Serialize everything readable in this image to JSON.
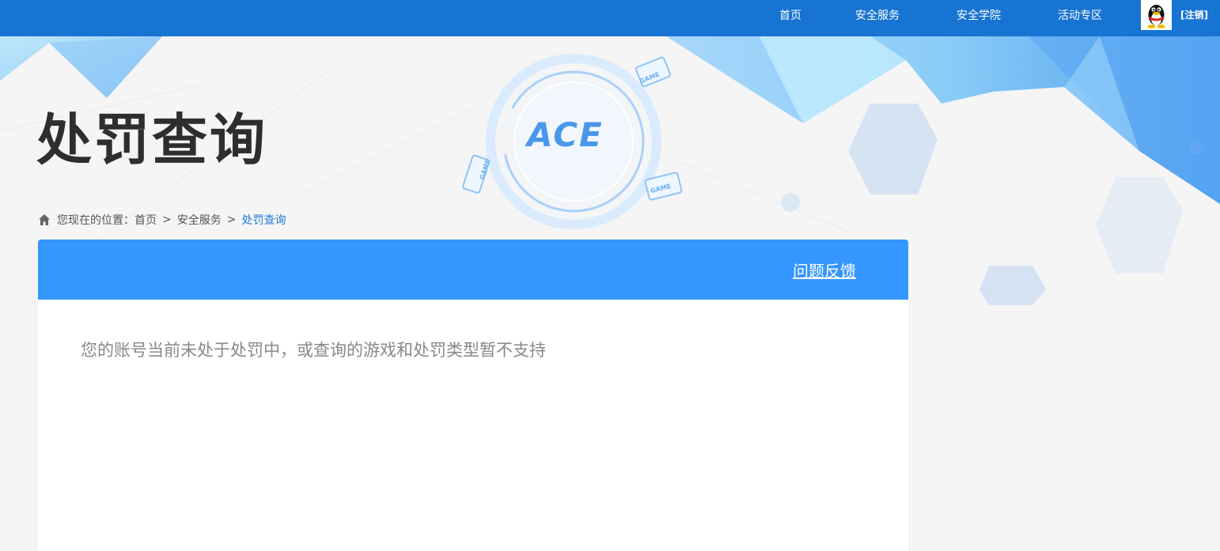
{
  "nav": {
    "items": [
      {
        "label": "首页"
      },
      {
        "label": "安全服务"
      },
      {
        "label": "安全学院"
      },
      {
        "label": "活动专区"
      }
    ],
    "logout_label": "[注销]"
  },
  "hero": {
    "title": "处罚查询",
    "logo_text": "ACE",
    "badge_text": "GAME"
  },
  "breadcrumb": {
    "prefix": "您现在的位置：",
    "items": [
      {
        "label": "首页"
      },
      {
        "label": "安全服务"
      },
      {
        "label": "处罚查询"
      }
    ],
    "separator": ">"
  },
  "panel": {
    "feedback_label": "问题反馈",
    "message": "您的账号当前未处于处罚中，或查询的游戏和处罚类型暂不支持"
  },
  "colors": {
    "topbar": "#1874d2",
    "panel_header": "#3496fe",
    "breadcrumb_current": "#1f7ad6"
  }
}
